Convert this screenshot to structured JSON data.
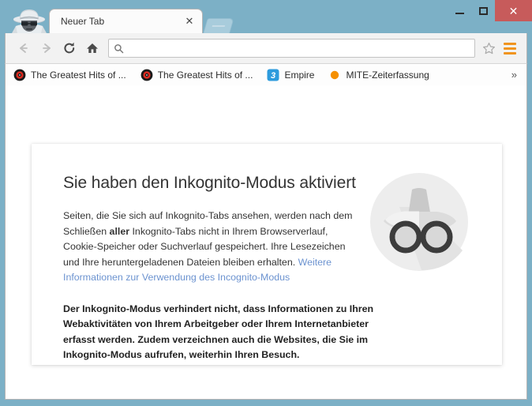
{
  "window": {
    "controls": {
      "minimize_label": "Minimize",
      "maximize_label": "Maximize",
      "close_label": "✕"
    },
    "avatar_icon": "incognito-spy-avatar-icon"
  },
  "tabs": {
    "active": {
      "title": "Neuer Tab",
      "close_label": "✕"
    },
    "new_tab_button_label": "Neuer Tab öffnen"
  },
  "toolbar": {
    "back_icon": "arrow-left-icon",
    "forward_icon": "arrow-right-icon",
    "reload_icon": "reload-icon",
    "home_icon": "home-icon",
    "search_icon": "search-icon",
    "star_icon": "star-icon",
    "menu_icon": "hamburger-menu-icon",
    "omnibox": {
      "value": "",
      "placeholder": ""
    }
  },
  "bookmarks": [
    {
      "label": "The Greatest Hits of ...",
      "favicon": "vinyl-record-favicon"
    },
    {
      "label": "The Greatest Hits of ...",
      "favicon": "vinyl-record-favicon"
    },
    {
      "label": "Empire",
      "favicon": "blue-three-favicon"
    },
    {
      "label": "MITE-Zeiterfassung",
      "favicon": "orange-dot-favicon"
    }
  ],
  "bookmarks_overflow_label": "»",
  "page": {
    "heading": "Sie haben den Inkognito-Modus aktiviert",
    "paragraph_1": {
      "part_1": "Seiten, die Sie sich auf Inkognito-Tabs ansehen, werden nach dem Schließen ",
      "bold": "aller",
      "part_2": " Inkognito-Tabs nicht in Ihrem Browserverlauf, Cookie-Speicher oder Suchverlauf gespeichert. Ihre Lesezeichen und Ihre heruntergeladenen Dateien bleiben erhalten. ",
      "link": "Weitere Informationen zur Verwendung des Incognito-Modus"
    },
    "paragraph_2": "Der Inkognito-Modus verhindert nicht, dass Informationen zu Ihren Webaktivitäten von Ihrem Arbeitgeber oder Ihrem Internetanbieter erfasst werden. Zudem verzeichnen auch die Websites, die Sie im Inkognito-Modus aufrufen, weiterhin Ihren Besuch.",
    "illustration_icon": "incognito-hat-glasses-icon"
  },
  "colors": {
    "titlebar": "#7cb0c6",
    "close_button": "#c75b5b",
    "menu_accent": "#f0941e",
    "link": "#6c93d0",
    "bookmark_blue": "#2d9bdd",
    "bookmark_orange": "#f59000"
  }
}
